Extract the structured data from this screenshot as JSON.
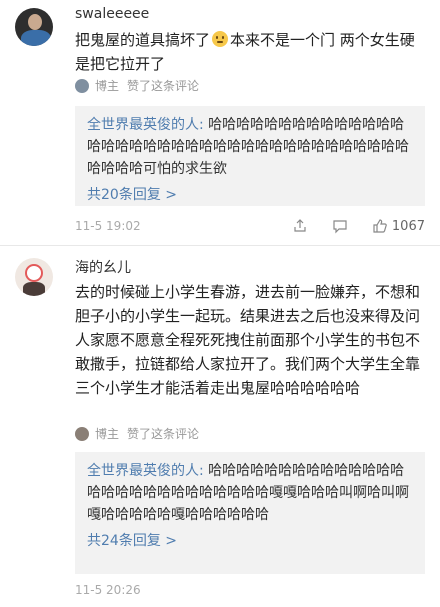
{
  "comments": [
    {
      "username": "swaleeeee",
      "text_before_emoji": "把鬼屋的道具搞坏了",
      "emoji": "smile-emoji",
      "text_after_emoji": "本来不是一个门 两个女生硬是把它拉开了",
      "like_note": {
        "blogger": "博主",
        "action": "赞了这条评论"
      },
      "reply": {
        "user": "全世界最英俊的人:",
        "text": " 哈哈哈哈哈哈哈哈哈哈哈哈哈哈哈哈哈哈哈哈哈哈哈哈哈哈哈哈哈哈哈哈哈哈哈哈哈哈哈哈哈可怕的求生欲",
        "more": "共20条回复 >"
      },
      "date": "11-5 19:02",
      "like_count": "1067"
    },
    {
      "username": "海的幺儿",
      "text": "去的时候碰上小学生春游，进去前一脸嫌弃，不想和胆子小的小学生一起玩。结果进去之后也没来得及问人家愿不愿意全程死死拽住前面那个小学生的书包不敢撒手，拉链都给人家拉开了。我们两个大学生全靠三个小学生才能活着走出鬼屋哈哈哈哈哈哈",
      "like_note": {
        "blogger": "博主",
        "action": "赞了这条评论"
      },
      "reply": {
        "user": "全世界最英俊的人:",
        "text": " 哈哈哈哈哈哈哈哈哈哈哈哈哈哈哈哈哈哈哈哈哈哈哈哈哈哈哈嘎嘎哈哈哈叫啊哈叫啊嘎哈哈哈哈哈嘎哈哈哈哈哈哈",
        "more": "共24条回复 >"
      },
      "date": "11-5 20:26"
    }
  ],
  "icons": [
    "share-icon",
    "comment-icon",
    "like-icon"
  ]
}
